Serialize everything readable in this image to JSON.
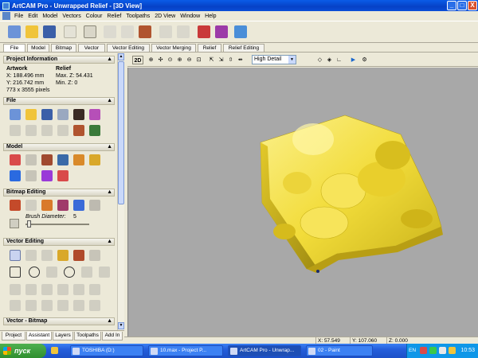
{
  "window": {
    "title": "ArtCAM Pro - Unwrapped Relief - [3D View]",
    "buttons": [
      "_",
      "□",
      "X"
    ]
  },
  "menu": [
    "File",
    "Edit",
    "Model",
    "Vectors",
    "Colour",
    "Relief",
    "Toolpaths",
    "2D View",
    "Window",
    "Help"
  ],
  "toolbar_icons": [
    "new-doc-icon",
    "open-folder-icon",
    "save-disk-icon",
    "grid-icon",
    "rectangle-icon",
    "cut-icon",
    "copy-icon",
    "paste-icon",
    "undo-icon",
    "redo-icon",
    "pen-icon",
    "book-icon",
    "wizard-icon"
  ],
  "main_tabs": [
    "File",
    "Model",
    "Bitmap",
    "Vector",
    "Vector Editing",
    "Vector Merging",
    "Relief",
    "Relief Editing"
  ],
  "project_info": {
    "title": "Project Information",
    "artwork_label": "Artwork",
    "relief_label": "Relief",
    "x": "X: 188.496 mm",
    "y": "Y: 216.742 mm",
    "max_z": "Max. Z: 54.431",
    "min_z": "Min. Z: 0",
    "pixels": "773 x 3555 pixels"
  },
  "sections": {
    "file": "File",
    "model": "Model",
    "bitmap_editing": "Bitmap Editing",
    "vector_editing": "Vector Editing",
    "vector_bitmap": "Vector - Bitmap"
  },
  "brush": {
    "label": "Brush Diameter:",
    "value": "5"
  },
  "left_bottom_tabs": [
    "Project",
    "Assistant",
    "Layers",
    "Toolpaths",
    "Add In"
  ],
  "view_toolbar": {
    "mode_2d": "2D",
    "detail": "High Detail"
  },
  "status": {
    "x": "X: 57.549",
    "y": "Y: 107.060",
    "z": "Z: 0.000"
  },
  "taskbar": {
    "start": "пуск",
    "tasks": [
      "TOSHIBA (D:)",
      "10.max - Project P...",
      "ArtCAM Pro - Unwrap...",
      "02 - Paint"
    ],
    "lang": "EN",
    "clock": "10:53"
  },
  "colors": {
    "relief": "#f2dc3a",
    "viewport": "#a8a8a8",
    "titlebar": "#0a5ce8"
  }
}
